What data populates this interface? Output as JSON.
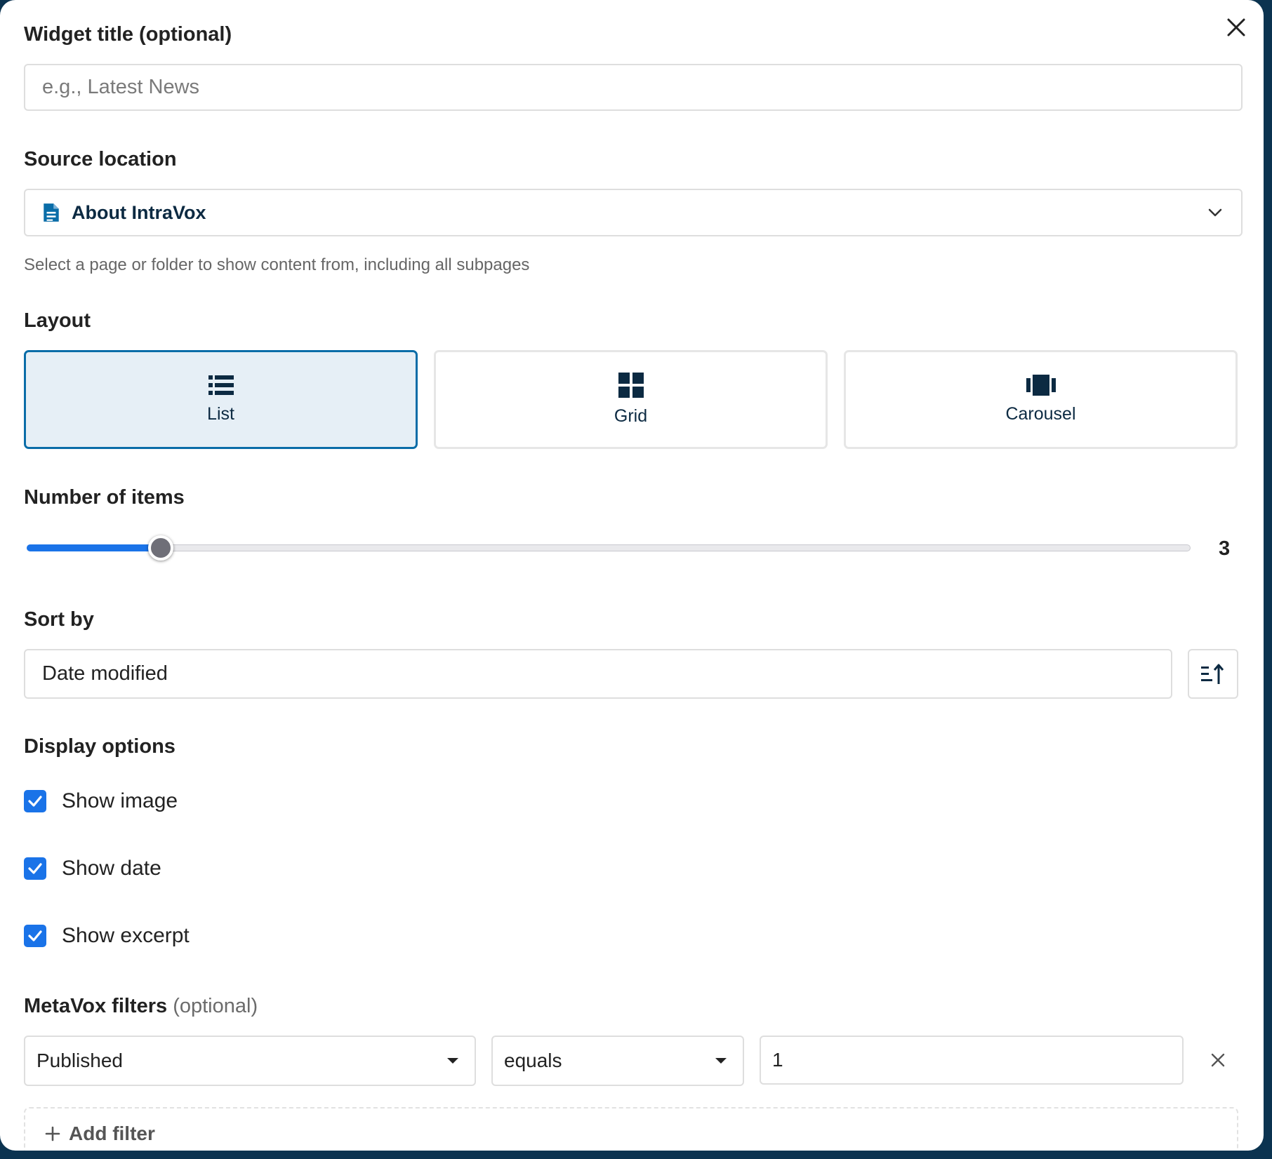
{
  "form": {
    "widget_title": {
      "label": "Widget title (optional)",
      "placeholder": "e.g., Latest News",
      "value": ""
    },
    "source_location": {
      "label": "Source location",
      "selected": "About IntraVox",
      "hint": "Select a page or folder to show content from, including all subpages"
    },
    "layout": {
      "label": "Layout",
      "options": [
        {
          "label": "List",
          "icon": "list-icon",
          "selected": true
        },
        {
          "label": "Grid",
          "icon": "grid-icon",
          "selected": false
        },
        {
          "label": "Carousel",
          "icon": "carousel-icon",
          "selected": false
        }
      ]
    },
    "number_of_items": {
      "label": "Number of items",
      "value": "3",
      "fraction": 0.115
    },
    "sort_by": {
      "label": "Sort by",
      "selected": "Date modified",
      "order_icon": "sort-ascending-icon"
    },
    "display_options": {
      "label": "Display options",
      "items": [
        {
          "label": "Show image",
          "checked": true
        },
        {
          "label": "Show date",
          "checked": true
        },
        {
          "label": "Show excerpt",
          "checked": true
        }
      ]
    },
    "metavox_filters": {
      "label": "MetaVox filters",
      "optional": "(optional)",
      "filters": [
        {
          "field": "Published",
          "operator": "equals",
          "value": "1"
        }
      ],
      "add_label": "Add filter"
    }
  },
  "colors": {
    "accent": "#1a73e8",
    "selected_border": "#0a6da8",
    "selected_bg": "#e6eff6",
    "backdrop": "#0b3350"
  }
}
